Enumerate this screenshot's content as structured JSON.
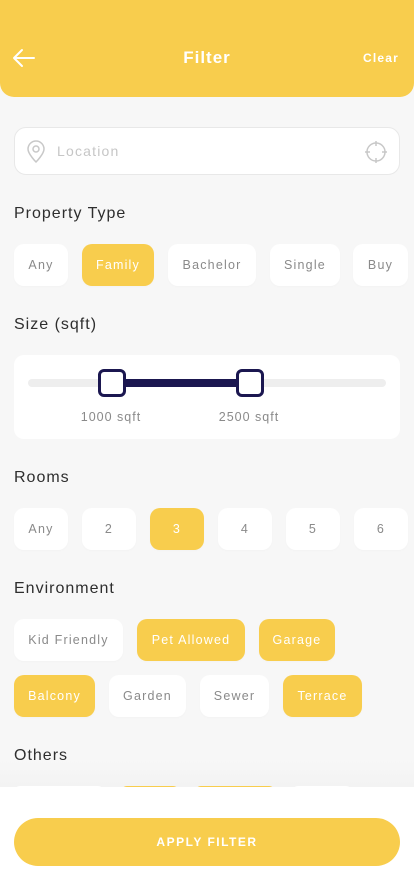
{
  "header": {
    "title": "Filter",
    "clear_label": "Clear",
    "back_icon": "arrow-left-icon"
  },
  "location": {
    "placeholder": "Location",
    "value": "",
    "pin_icon": "location-pin-icon",
    "locate_icon": "crosshair-icon"
  },
  "property_type": {
    "title": "Property Type",
    "options": [
      {
        "label": "Any",
        "selected": false
      },
      {
        "label": "Family",
        "selected": true
      },
      {
        "label": "Bachelor",
        "selected": false
      },
      {
        "label": "Single",
        "selected": false
      },
      {
        "label": "Buy",
        "selected": false
      }
    ]
  },
  "size": {
    "title": "Size (sqft)",
    "min_label": "1000 sqft",
    "max_label": "2500 sqft",
    "range_fraction": [
      0.23,
      0.62
    ]
  },
  "rooms": {
    "title": "Rooms",
    "options": [
      {
        "label": "Any",
        "selected": false
      },
      {
        "label": "2",
        "selected": false
      },
      {
        "label": "3",
        "selected": true
      },
      {
        "label": "4",
        "selected": false
      },
      {
        "label": "5",
        "selected": false
      },
      {
        "label": "6",
        "selected": false
      }
    ]
  },
  "environment": {
    "title": "Environment",
    "options": [
      {
        "label": "Kid Friendly",
        "selected": false
      },
      {
        "label": "Pet Allowed",
        "selected": true
      },
      {
        "label": "Garage",
        "selected": true
      },
      {
        "label": "Balcony",
        "selected": true
      },
      {
        "label": "Garden",
        "selected": false
      },
      {
        "label": "Sewer",
        "selected": false
      },
      {
        "label": "Terrace",
        "selected": true
      }
    ]
  },
  "others": {
    "title": "Others"
  },
  "apply": {
    "label": "APPLY FILTER"
  },
  "colors": {
    "accent": "#f8cd4d",
    "slider": "#1b1750",
    "chip_text": "#8a8a8a",
    "background": "#f7f7f7"
  }
}
